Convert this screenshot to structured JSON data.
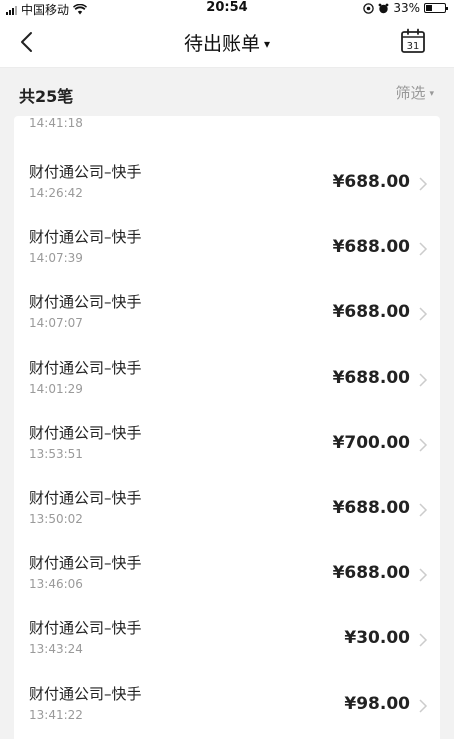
{
  "status_bar": {
    "carrier": "中国移动",
    "time": "20:54",
    "battery": "33%",
    "battery_level": 0.33,
    "icons": [
      "signal-icon",
      "wifi-icon",
      "location-icon",
      "alarm-icon",
      "battery-icon"
    ]
  },
  "nav": {
    "title": "待出账单",
    "title_caret": "▾",
    "calendar_day": "31",
    "icons": [
      "back-chevron-icon",
      "calendar-icon"
    ]
  },
  "summary": {
    "count_label": "共25笔",
    "filter_label": "筛选",
    "filter_caret": "▾"
  },
  "list": {
    "partial_item": {
      "time": "14:41:18"
    },
    "items": [
      {
        "name": "财付通公司–快手",
        "time": "14:26:42",
        "amount": "¥688.00"
      },
      {
        "name": "财付通公司–快手",
        "time": "14:07:39",
        "amount": "¥688.00"
      },
      {
        "name": "财付通公司–快手",
        "time": "14:07:07",
        "amount": "¥688.00"
      },
      {
        "name": "财付通公司–快手",
        "time": "14:01:29",
        "amount": "¥688.00"
      },
      {
        "name": "财付通公司–快手",
        "time": "13:53:51",
        "amount": "¥700.00"
      },
      {
        "name": "财付通公司–快手",
        "time": "13:50:02",
        "amount": "¥688.00"
      },
      {
        "name": "财付通公司–快手",
        "time": "13:46:06",
        "amount": "¥688.00"
      },
      {
        "name": "财付通公司–快手",
        "time": "13:43:24",
        "amount": "¥30.00"
      },
      {
        "name": "财付通公司–快手",
        "time": "13:41:22",
        "amount": "¥98.00"
      }
    ],
    "colors": {
      "name": "#222222",
      "time": "#9a9a9a",
      "amount": "#222222",
      "chevron": "#cccccc"
    }
  }
}
